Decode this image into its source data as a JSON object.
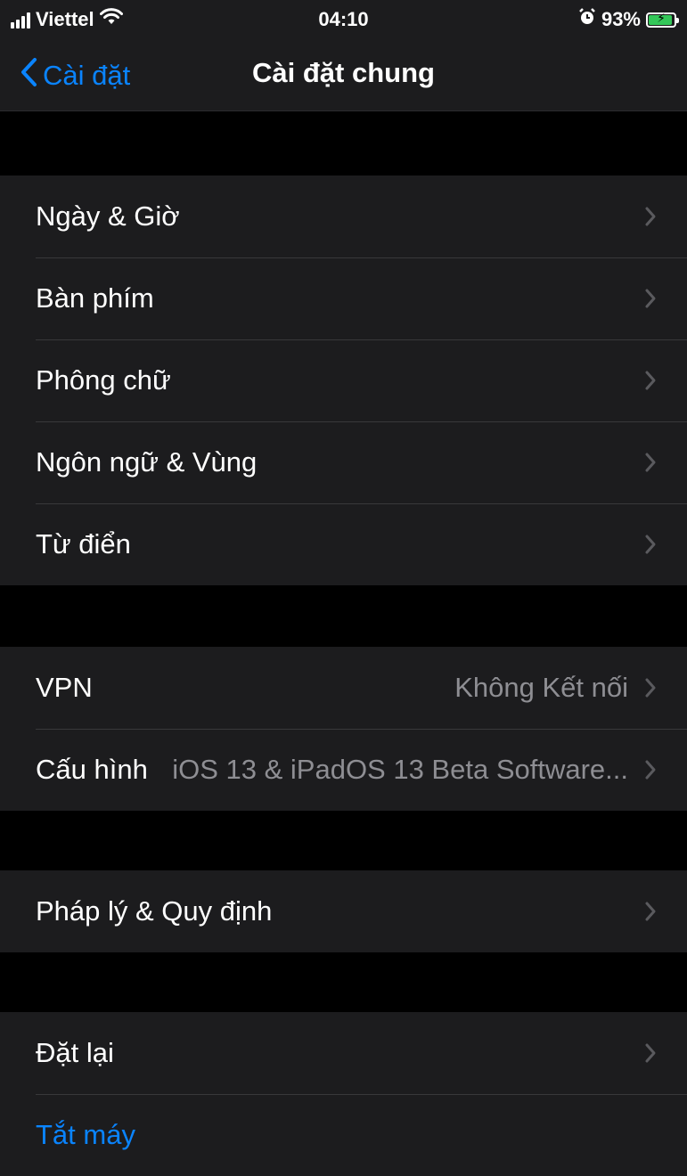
{
  "status": {
    "carrier": "Viettel",
    "time": "04:10",
    "battery": "93%",
    "battery_level": 0.93
  },
  "nav": {
    "back_label": "Cài đặt",
    "title": "Cài đặt chung"
  },
  "groups": [
    {
      "items": [
        {
          "label": "Ngày & Giờ"
        },
        {
          "label": "Bàn phím"
        },
        {
          "label": "Phông chữ"
        },
        {
          "label": "Ngôn ngữ & Vùng"
        },
        {
          "label": "Từ điển"
        }
      ]
    },
    {
      "items": [
        {
          "label": "VPN",
          "value": "Không Kết nối"
        },
        {
          "label": "Cấu hình",
          "value": "iOS 13 & iPadOS 13 Beta Software..."
        }
      ]
    },
    {
      "items": [
        {
          "label": "Pháp lý & Quy định"
        }
      ]
    },
    {
      "items": [
        {
          "label": "Đặt lại"
        },
        {
          "label": "Tắt máy"
        }
      ]
    }
  ],
  "colors": {
    "accent": "#0a84ff",
    "background": "#000000",
    "cell": "#1c1c1e",
    "secondary_text": "#8e8e93",
    "battery_green": "#34c759"
  },
  "icons": [
    "signal-icon",
    "wifi-icon",
    "alarm-icon",
    "battery-icon",
    "back-chevron-icon",
    "chevron-right-icon"
  ]
}
